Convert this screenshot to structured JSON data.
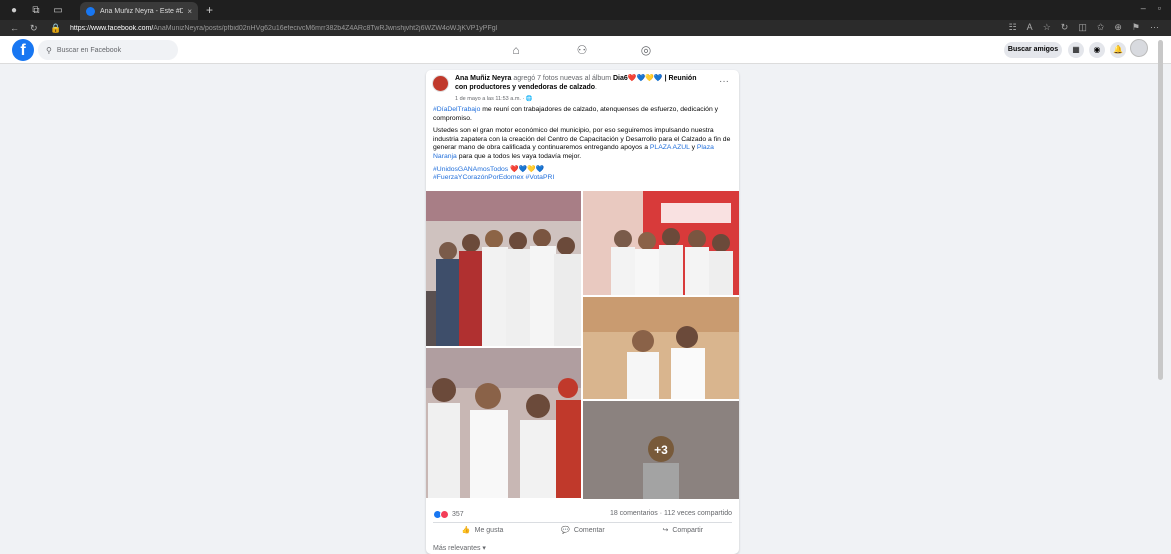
{
  "browser": {
    "tab_title": "Ana Muñiz Neyra - Este #DíaDel",
    "tab_close": "×",
    "new_tab": "+",
    "url_host": "https://www.facebook.com/",
    "url_rest": "AnaMunizNeyra/posts/pfbid02nHVg62u16efecivcM6mrr382b4Z4ARc8TwRJwnshjvht2j6WZW4oWJjKVP1yPFgl"
  },
  "header": {
    "search_placeholder": "Buscar en Facebook",
    "buscar_amigos": "Buscar amigos"
  },
  "post": {
    "author": "Ana Muñiz Neyra",
    "action": " agregó 7 fotos nuevas al álbum ",
    "album": "Dia6❤️💙💛💙 | Reunión con productores y vendedoras de calzado",
    "period": ".",
    "timestamp": "1 de mayo a las 11:53 a.m. · 🌐",
    "more": "···",
    "hashtag1": "#DíaDelTrabajo",
    "text1": " me reuní con trabajadores de calzado, atenquenses de esfuerzo, dedicación y compromiso.",
    "text2": "Ustedes son el gran motor económico del municipio, por eso seguiremos impulsando nuestra industria zapatera con la creación del Centro de Capacitación y Desarrollo para el Calzado a fin de generar mano de obra calificada y continuaremos entregando apoyos a ",
    "link_plaza_azul": "PLAZA AZUL",
    "and": " y ",
    "link_plaza_naranja": "Plaza Naranja",
    "text2_end": " para que a todos les vaya todavía mejor.",
    "hashtag_unidos": "#UnidosGANAmosTodos ❤️💙💛💙",
    "hashtags_bottom": "#FuerzaYCorazónPorEdomex #VotaPRI",
    "more_photos": "+3",
    "reaction_count": "357",
    "comments_shares": "18 comentarios · 112 veces compartido",
    "like": "Me gusta",
    "comment": "Comentar",
    "share": "Compartir",
    "relevance": "Más relevantes ▾"
  },
  "colors": {
    "facebook_blue": "#1877f2",
    "link_blue": "#216fdb",
    "like_blue": "#1877f2",
    "love_red": "#f33e58"
  }
}
